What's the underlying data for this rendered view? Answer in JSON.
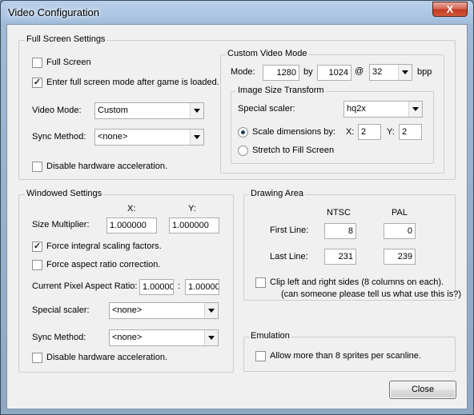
{
  "window": {
    "title": "Video Configuration",
    "close_glyph": "X"
  },
  "fullscreen": {
    "legend": "Full Screen Settings",
    "full_screen": {
      "label": "Full Screen",
      "checked": false
    },
    "enter_after_load": {
      "label": "Enter full screen mode after game is loaded.",
      "checked": true
    },
    "video_mode": {
      "label": "Video Mode:",
      "value": "Custom"
    },
    "sync_method": {
      "label": "Sync Method:",
      "value": "<none>"
    },
    "disable_hw": {
      "label": "Disable hardware acceleration.",
      "checked": false
    }
  },
  "custom": {
    "legend": "Custom Video Mode",
    "mode_label": "Mode:",
    "width": "1280",
    "by": "by",
    "height": "1024",
    "at": "@",
    "bpp": "32",
    "bpp_label": "bpp"
  },
  "transform": {
    "legend": "Image Size Transform",
    "special_scaler": {
      "label": "Special scaler:",
      "value": "hq2x"
    },
    "scale_dims": {
      "label": "Scale dimensions by:",
      "selected": true
    },
    "x_label": "X:",
    "x_value": "2",
    "y_label": "Y:",
    "y_value": "2",
    "stretch": {
      "label": "Stretch to Fill Screen",
      "selected": false
    }
  },
  "windowed": {
    "legend": "Windowed Settings",
    "x_header": "X:",
    "y_header": "Y:",
    "size_multiplier": {
      "label": "Size Multiplier:",
      "x": "1.000000",
      "y": "1.000000"
    },
    "force_integral": {
      "label": "Force integral scaling factors.",
      "checked": true
    },
    "force_aspect": {
      "label": "Force aspect ratio correction.",
      "checked": false
    },
    "pixel_aspect": {
      "label": "Current Pixel Aspect Ratio:",
      "x": "1.00000",
      "sep": ":",
      "y": "1.00000"
    },
    "special_scaler": {
      "label": "Special scaler:",
      "value": "<none>"
    },
    "sync_method": {
      "label": "Sync Method:",
      "value": "<none>"
    },
    "disable_hw": {
      "label": "Disable hardware acceleration.",
      "checked": false
    }
  },
  "drawing": {
    "legend": "Drawing Area",
    "ntsc_header": "NTSC",
    "pal_header": "PAL",
    "first_line": {
      "label": "First Line:",
      "ntsc": "8",
      "pal": "0"
    },
    "last_line": {
      "label": "Last Line:",
      "ntsc": "231",
      "pal": "239"
    },
    "clip_sides": {
      "label": "Clip left and right sides (8 columns on each).",
      "checked": false
    },
    "clip_note": "(can someone please tell us what use this is?)"
  },
  "emulation": {
    "legend": "Emulation",
    "sprites": {
      "label": "Allow more than 8 sprites per scanline.",
      "checked": false
    }
  },
  "buttons": {
    "close": "Close"
  }
}
